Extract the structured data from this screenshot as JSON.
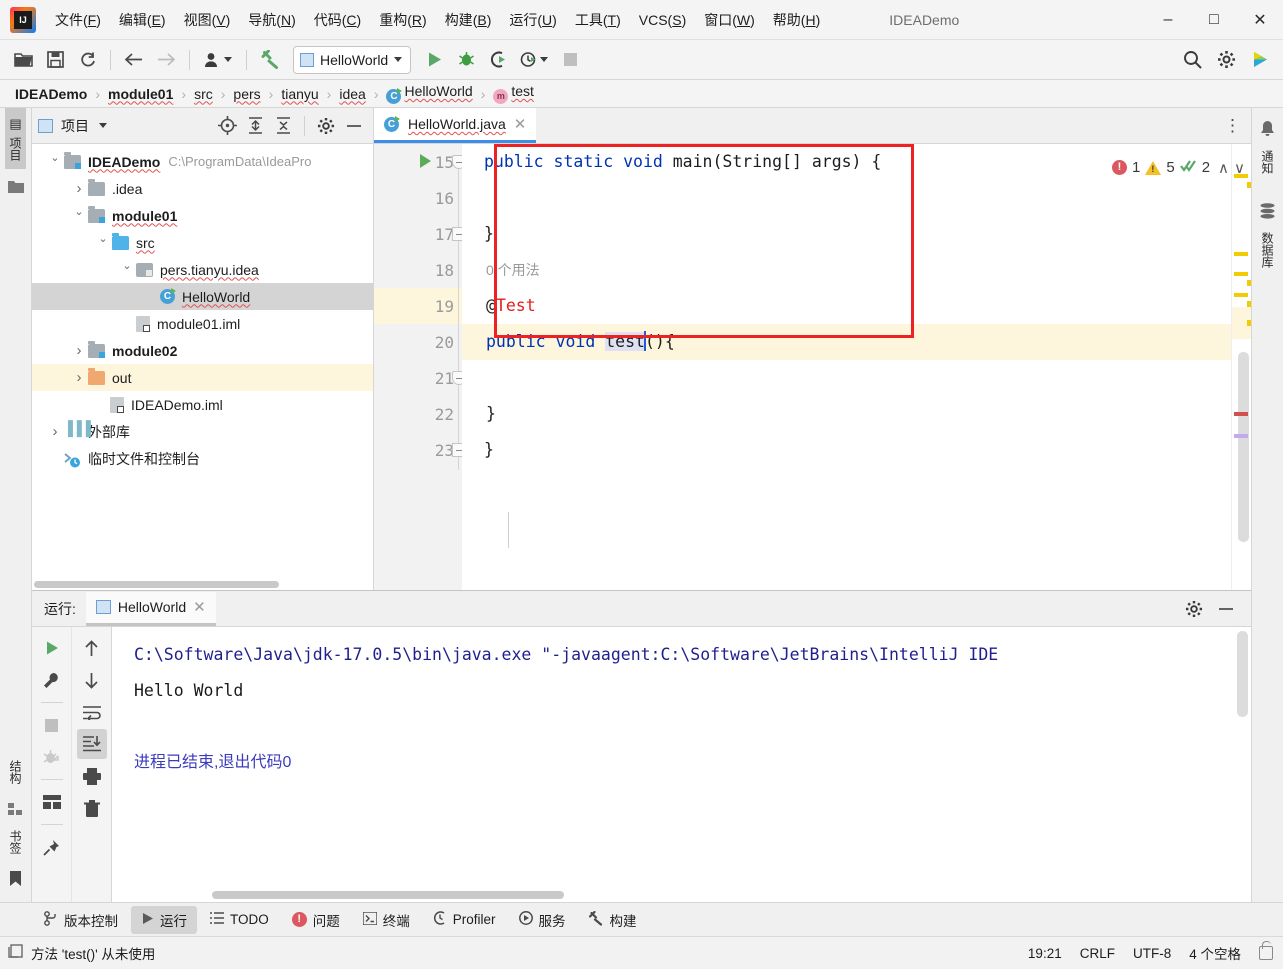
{
  "window": {
    "title": "IDEADemo",
    "minimize": "–",
    "maximize": "□",
    "close": "✕"
  },
  "menubar": [
    {
      "label": "文件",
      "mnemonic": "F"
    },
    {
      "label": "编辑",
      "mnemonic": "E"
    },
    {
      "label": "视图",
      "mnemonic": "V"
    },
    {
      "label": "导航",
      "mnemonic": "N"
    },
    {
      "label": "代码",
      "mnemonic": "C"
    },
    {
      "label": "重构",
      "mnemonic": "R"
    },
    {
      "label": "构建",
      "mnemonic": "B"
    },
    {
      "label": "运行",
      "mnemonic": "U"
    },
    {
      "label": "工具",
      "mnemonic": "T"
    },
    {
      "label": "VCS",
      "mnemonic": "S"
    },
    {
      "label": "窗口",
      "mnemonic": "W"
    },
    {
      "label": "帮助",
      "mnemonic": "H"
    }
  ],
  "toolbar": {
    "open_icon": "open-folder-icon",
    "save_icon": "save-icon",
    "sync_icon": "sync-icon",
    "back_icon": "back-arrow-icon",
    "forward_icon": "forward-arrow-icon",
    "profile_icon": "user-icon",
    "build_icon": "hammer-icon",
    "run_config": "HelloWorld",
    "run_icon": "run-icon",
    "debug_icon": "debug-icon",
    "run_coverage_icon": "run-with-coverage-icon",
    "profiler_icon": "profiler-icon",
    "stop_icon": "stop-icon",
    "search_icon": "search-icon",
    "settings_icon": "gear-icon",
    "ide_icon": "ide-feature-icon"
  },
  "breadcrumb": [
    {
      "label": "IDEADemo",
      "bold": true,
      "squiggly": false,
      "icon": ""
    },
    {
      "label": "module01",
      "bold": true,
      "squiggly": true,
      "icon": ""
    },
    {
      "label": "src",
      "bold": false,
      "squiggly": true,
      "icon": ""
    },
    {
      "label": "pers",
      "bold": false,
      "squiggly": true,
      "icon": ""
    },
    {
      "label": "tianyu",
      "bold": false,
      "squiggly": true,
      "icon": ""
    },
    {
      "label": "idea",
      "bold": false,
      "squiggly": true,
      "icon": ""
    },
    {
      "label": "HelloWorld",
      "bold": false,
      "squiggly": true,
      "icon": "class-icon"
    },
    {
      "label": "test",
      "bold": false,
      "squiggly": true,
      "icon": "method-icon"
    }
  ],
  "breadcrumb_separator": "›",
  "left_strip": {
    "project_tab": "项目",
    "structure_tab": "结构",
    "bookmarks_tab": "书签"
  },
  "right_strip": {
    "notifications_tab": "通知",
    "database_tab": "数据库"
  },
  "project_panel": {
    "title": "项目",
    "dropdown_icon": "chevron-down-icon",
    "actions": [
      "locate-icon",
      "expand-all-icon",
      "collapse-all-icon",
      "gear-icon",
      "hide-icon"
    ],
    "tree": [
      {
        "label": "IDEADemo",
        "path": "C:\\ProgramData\\IdeaPro",
        "depth": 0,
        "chev": "down",
        "icon": "mod",
        "bold": true,
        "squiggly": true,
        "state": "normal"
      },
      {
        "label": ".idea",
        "path": "",
        "depth": 1,
        "chev": "right",
        "icon": "plain",
        "bold": false,
        "squiggly": false,
        "state": "normal"
      },
      {
        "label": "module01",
        "path": "",
        "depth": 1,
        "chev": "down",
        "icon": "mod",
        "bold": true,
        "squiggly": true,
        "state": "normal"
      },
      {
        "label": "src",
        "path": "",
        "depth": 2,
        "chev": "down",
        "icon": "src",
        "bold": false,
        "squiggly": true,
        "state": "normal"
      },
      {
        "label": "pers.tianyu.idea",
        "path": "",
        "depth": 3,
        "chev": "down",
        "icon": "pkg",
        "bold": false,
        "squiggly": true,
        "state": "normal"
      },
      {
        "label": "HelloWorld",
        "path": "",
        "depth": 4,
        "chev": "none",
        "icon": "class",
        "bold": false,
        "squiggly": true,
        "state": "selected"
      },
      {
        "label": "module01.iml",
        "path": "",
        "depth": 3,
        "chev": "none",
        "icon": "iml",
        "bold": false,
        "squiggly": false,
        "state": "normal"
      },
      {
        "label": "module02",
        "path": "",
        "depth": 1,
        "chev": "right",
        "icon": "mod",
        "bold": true,
        "squiggly": false,
        "state": "normal"
      },
      {
        "label": "out",
        "path": "",
        "depth": 1,
        "chev": "right",
        "icon": "out",
        "bold": false,
        "squiggly": false,
        "state": "highlight"
      },
      {
        "label": "IDEADemo.iml",
        "path": "",
        "depth": 2,
        "chev": "none",
        "icon": "iml",
        "bold": false,
        "squiggly": false,
        "state": "normal"
      },
      {
        "label": "外部库",
        "path": "",
        "depth": 0,
        "chev": "right",
        "icon": "lib",
        "bold": false,
        "squiggly": false,
        "state": "normal"
      },
      {
        "label": "临时文件和控制台",
        "path": "",
        "depth": 0,
        "chev": "none",
        "icon": "scratch",
        "bold": false,
        "squiggly": false,
        "state": "normal"
      }
    ]
  },
  "editor": {
    "tab": {
      "label": "HelloWorld.java",
      "icon": "class-icon",
      "close": "✕"
    },
    "more_icon": "more-vertical-icon",
    "inspections": {
      "error_count": "1",
      "warning_count": "5",
      "weak_warning_count": "2",
      "up": "∧",
      "down": "∨"
    },
    "lines": [
      {
        "num": "15",
        "runmark": true,
        "fold": "open",
        "highlight": false
      },
      {
        "num": "16",
        "runmark": false,
        "fold": "none",
        "highlight": false
      },
      {
        "num": "17",
        "runmark": false,
        "fold": "close",
        "highlight": false
      },
      {
        "num": "18",
        "runmark": false,
        "fold": "none",
        "highlight": false
      },
      {
        "num": "19",
        "runmark": false,
        "fold": "open",
        "highlight": true
      },
      {
        "num": "20",
        "runmark": false,
        "fold": "none",
        "highlight": false
      },
      {
        "num": "21",
        "runmark": false,
        "fold": "close",
        "highlight": false
      },
      {
        "num": "22",
        "runmark": false,
        "fold": "none",
        "highlight": false
      },
      {
        "num": "23",
        "runmark": false,
        "fold": "none",
        "highlight": false
      }
    ],
    "code": {
      "l15_kw1": "public static void",
      "l15_rest": " main(String[] args) {",
      "l17_brace": "}",
      "inlay_usages": "0 个用法",
      "annotation_at": "@",
      "annotation_name": "Test",
      "l19_kw": "public void",
      "l19_name": "test",
      "l19_tail": "(){",
      "l21_brace": "}",
      "l22_brace": "}"
    }
  },
  "run_panel": {
    "label": "运行:",
    "tab": {
      "label": "HelloWorld",
      "close": "✕"
    },
    "settings_icon": "gear-icon",
    "hide_icon": "hide-icon",
    "tools_left": [
      "rerun-icon",
      "wrench-icon",
      "stop-icon",
      "debug-disabled-icon",
      "layout-icon",
      "pin-icon"
    ],
    "tools_right": [
      "up-arrow-icon",
      "down-arrow-icon",
      "soft-wrap-icon",
      "scroll-to-end-icon",
      "print-icon",
      "trash-icon"
    ],
    "console": [
      {
        "text": "C:\\Software\\Java\\jdk-17.0.5\\bin\\java.exe \"-javaagent:C:\\Software\\JetBrains\\IntelliJ IDE",
        "style": "blue"
      },
      {
        "text": "Hello World",
        "style": "black"
      },
      {
        "text": "",
        "style": "black"
      },
      {
        "text": "进程已结束,退出代码0",
        "style": "exit"
      }
    ]
  },
  "bottom_tools": [
    {
      "label": "版本控制",
      "icon": "vcs-icon",
      "active": false
    },
    {
      "label": "运行",
      "icon": "run-icon",
      "active": true
    },
    {
      "label": "TODO",
      "icon": "todo-icon",
      "active": false
    },
    {
      "label": "问题",
      "icon": "problems-icon",
      "active": false
    },
    {
      "label": "终端",
      "icon": "terminal-icon",
      "active": false
    },
    {
      "label": "Profiler",
      "icon": "profiler-icon",
      "active": false
    },
    {
      "label": "服务",
      "icon": "services-icon",
      "active": false
    },
    {
      "label": "构建",
      "icon": "build-icon",
      "active": false
    }
  ],
  "statusbar": {
    "message_icon": "message-icon",
    "message": "方法 'test()' 从未使用",
    "position": "19:21",
    "line_sep": "CRLF",
    "encoding": "UTF-8",
    "indent": "4 个空格",
    "lock_icon": "lock-icon"
  },
  "colors": {
    "accent": "#3c8ee6",
    "error": "#db5860",
    "warning": "#f4c025",
    "success": "#59a869",
    "redbox": "#ee2222",
    "keyword": "#0033b3",
    "annotation": "#e02020"
  }
}
